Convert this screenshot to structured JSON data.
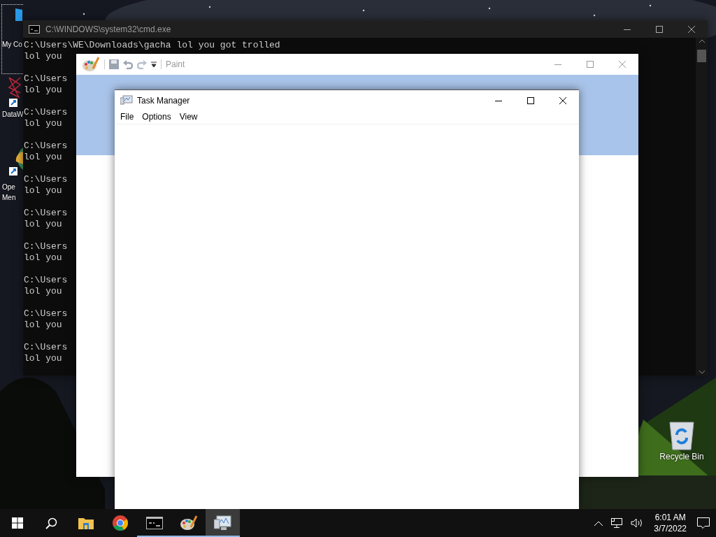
{
  "desktop_icons": [
    {
      "kind": "computer",
      "label_lines": [
        "My Co"
      ],
      "selected": true
    },
    {
      "kind": "molecule",
      "label_lines": [
        "DataW"
      ],
      "selected": false
    },
    {
      "kind": "globe",
      "label_lines": [
        "Ope",
        "Men"
      ],
      "selected": false
    }
  ],
  "recycle_bin": {
    "label": "Recycle Bin"
  },
  "cmd": {
    "title": "C:\\WINDOWS\\system32\\cmd.exe",
    "blocks": [
      {
        "prompt": "C:\\Users\\WE\\Downloads\\gacha lol you got trolled",
        "output": "lol you"
      },
      {
        "prompt": "C:\\Users",
        "output": "lol you"
      },
      {
        "prompt": "C:\\Users",
        "output": "lol you"
      },
      {
        "prompt": "C:\\Users",
        "output": "lol you"
      },
      {
        "prompt": "C:\\Users",
        "output": "lol you"
      },
      {
        "prompt": "C:\\Users",
        "output": "lol you"
      },
      {
        "prompt": "C:\\Users",
        "output": "lol you"
      },
      {
        "prompt": "C:\\Users",
        "output": "lol you"
      },
      {
        "prompt": "C:\\Users",
        "output": "lol you"
      },
      {
        "prompt": "C:\\Users",
        "output": "lol you"
      }
    ]
  },
  "paint": {
    "title": "Paint"
  },
  "task_manager": {
    "title": "Task Manager",
    "menu": [
      "File",
      "Options",
      "View"
    ]
  },
  "taskbar": {
    "buttons": [
      {
        "kind": "start",
        "open": false,
        "selected": false
      },
      {
        "kind": "search",
        "open": false,
        "selected": false
      },
      {
        "kind": "folder",
        "open": false,
        "selected": false
      },
      {
        "kind": "browser",
        "open": false,
        "selected": false
      },
      {
        "kind": "terminal",
        "open": true,
        "selected": false
      },
      {
        "kind": "palette",
        "open": true,
        "selected": false
      },
      {
        "kind": "monitor",
        "open": true,
        "selected": true
      }
    ],
    "time": "6:01 AM",
    "date": "3/7/2022"
  }
}
